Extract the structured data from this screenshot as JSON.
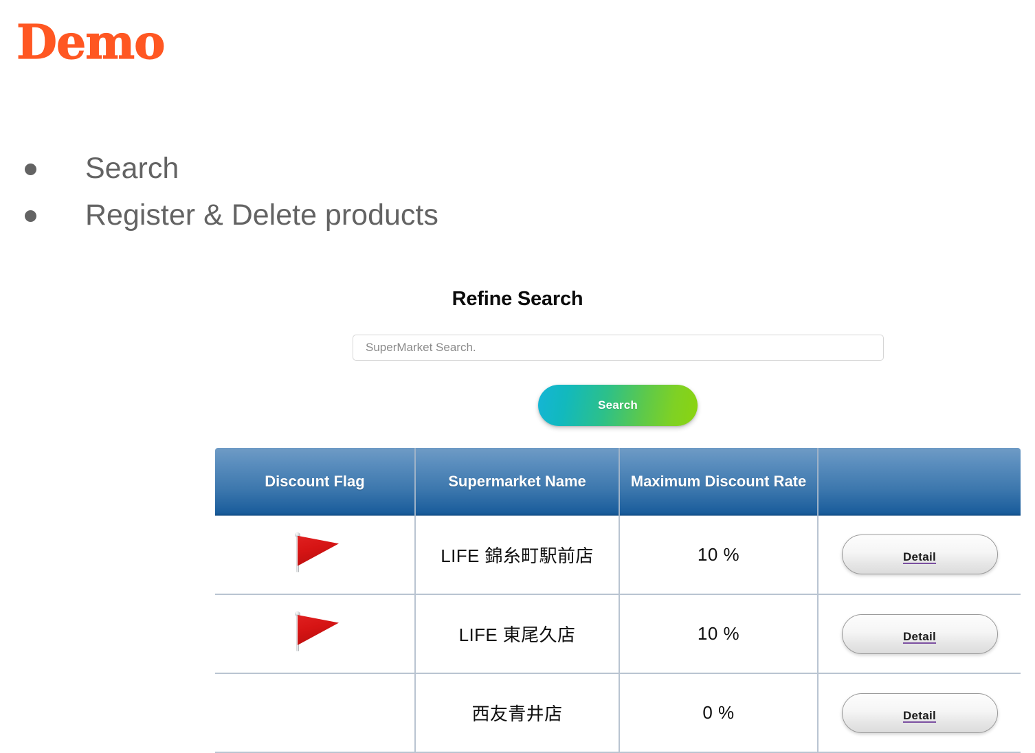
{
  "slide": {
    "title": "Demo",
    "title_color": "#FF5722",
    "bullets": [
      {
        "label": "Search"
      },
      {
        "label": "Register & Delete products"
      }
    ]
  },
  "refine_search": {
    "heading": "Refine Search",
    "input_placeholder": "SuperMarket Search.",
    "input_value": "",
    "search_button_label": "Search",
    "search_button_gradient_from": "#14b5d6",
    "search_button_gradient_to": "#8bd40f"
  },
  "results": {
    "columns": [
      "Discount Flag",
      "Supermarket Name",
      "Maximum Discount Rate",
      ""
    ],
    "header_color": "#1a5d9c",
    "rows": [
      {
        "flag_icon": "red-triangular-flag-icon",
        "has_flag": true,
        "name": "LIFE 錦糸町駅前店",
        "rate": "10 %",
        "action_label": "Detail"
      },
      {
        "flag_icon": "red-triangular-flag-icon",
        "has_flag": true,
        "name": "LIFE 東尾久店",
        "rate": "10 %",
        "action_label": "Detail"
      },
      {
        "flag_icon": "",
        "has_flag": false,
        "name": "西友青井店",
        "rate": "0 %",
        "action_label": "Detail"
      }
    ]
  }
}
